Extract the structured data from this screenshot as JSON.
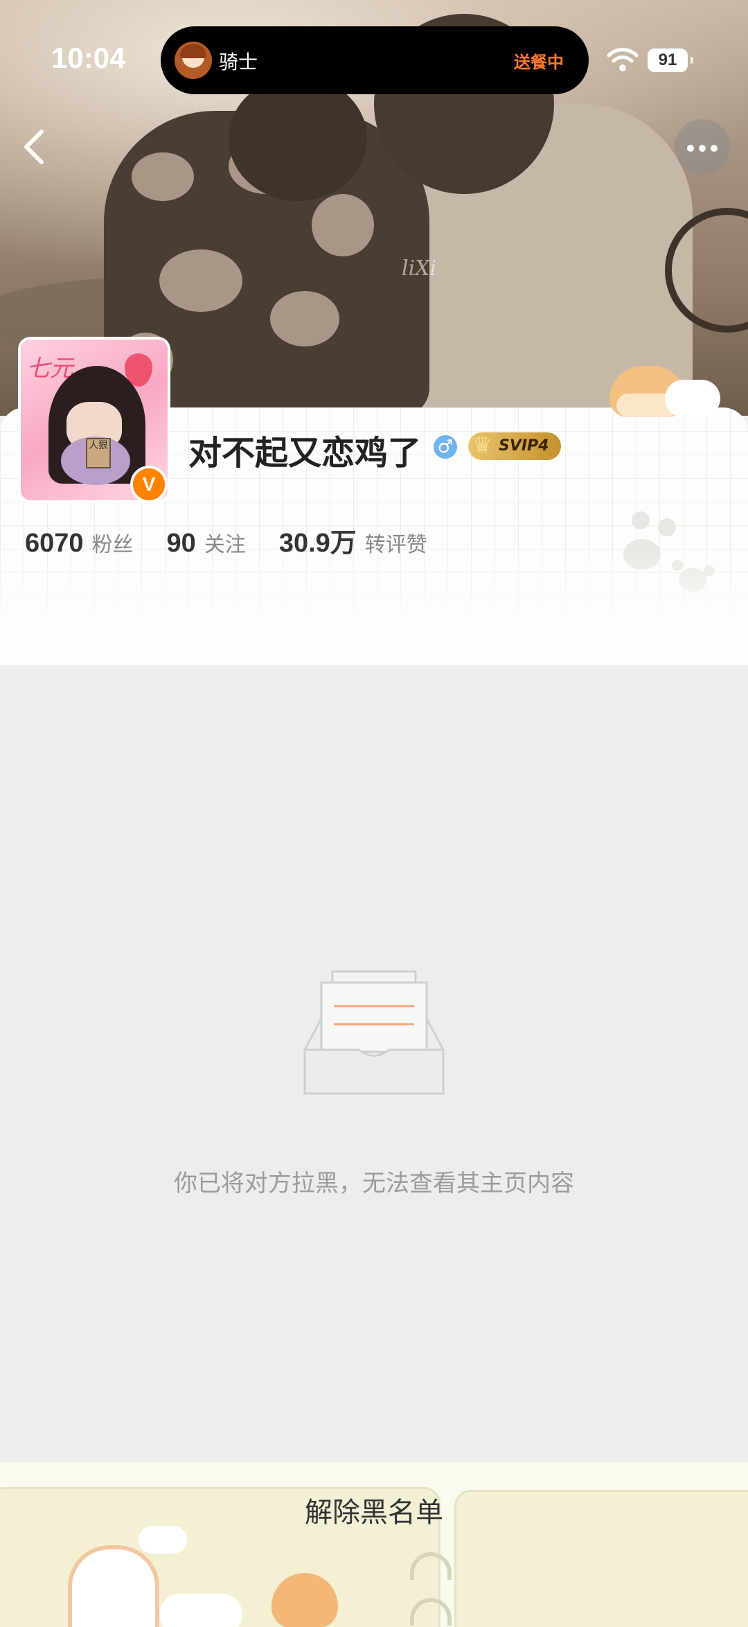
{
  "status_bar": {
    "time": "10:04",
    "live_activity": {
      "name": "骑士",
      "state": "送餐中"
    },
    "battery": "91"
  },
  "cover": {
    "watermark": "liXi"
  },
  "profile": {
    "username": "对不起又恋鸡了",
    "gender_icon": "male-symbol",
    "vip_badge": "SVIP4",
    "verified_badge": "V",
    "avatar_text": "人狠",
    "stats": [
      {
        "value": "6070",
        "label": "粉丝"
      },
      {
        "value": "90",
        "label": "关注"
      },
      {
        "value": "30.9万",
        "label": "转评赞"
      }
    ]
  },
  "blocked": {
    "message": "你已将对方拉黑，无法查看其主页内容"
  },
  "footer": {
    "unblock_label": "解除黑名单"
  },
  "colors": {
    "accent_orange": "#ff8200",
    "delivery_orange": "#ff7a2f",
    "vip_gold": "#e9c36d"
  }
}
